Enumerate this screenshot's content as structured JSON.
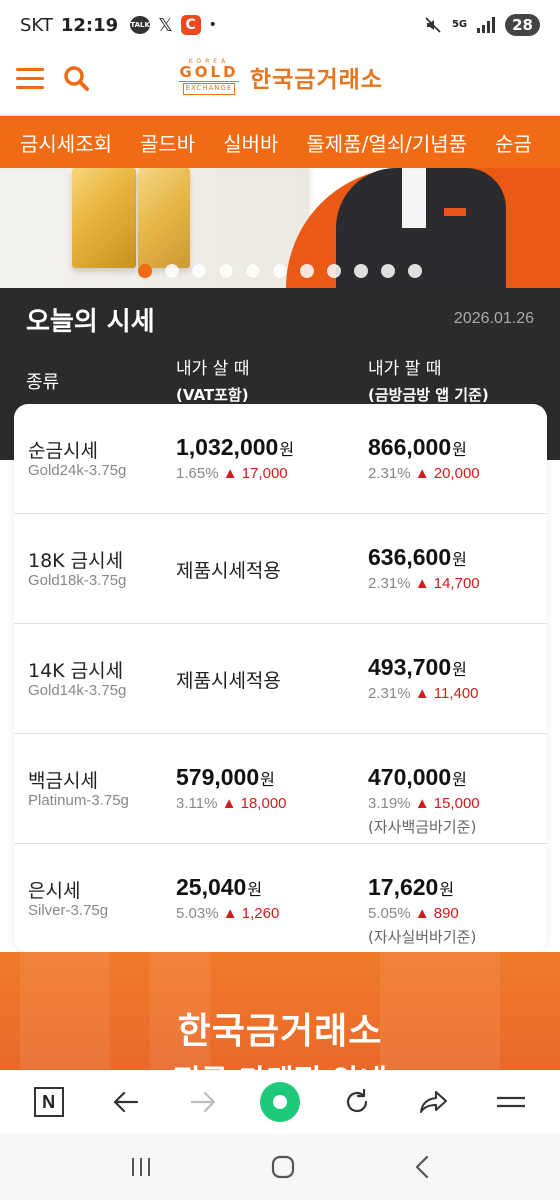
{
  "status_bar": {
    "carrier": "SKT",
    "time": "12:19",
    "talk_badge": "TALK",
    "x_icon": "𝕏",
    "c_icon": "C",
    "more_dot": "•",
    "network": "5G",
    "battery": "28"
  },
  "header": {
    "logo_korea": "KOREA",
    "logo_gold": "GOLD",
    "logo_exchange": "EXCHANGE",
    "logo_text": "한국금거래소"
  },
  "nav": {
    "items": [
      "금시세조회",
      "골드바",
      "실버바",
      "돌제품/열쇠/기념품",
      "순금"
    ]
  },
  "banner": {
    "slide_count": 11,
    "active_slide": 0
  },
  "price_section": {
    "title": "오늘의 시세",
    "date": "2026.01.26",
    "col_type": "종류",
    "col_buy": "내가 살 때",
    "col_buy_sub": "(VAT포함)",
    "col_sell": "내가 팔 때",
    "col_sell_sub": "(금방금방 앱 기준)",
    "won": "원",
    "up_arrow": "▲",
    "rows": [
      {
        "name": "순금시세",
        "sub": "Gold24k-3.75g",
        "buy_price": "1,032,000",
        "buy_pct": "1.65%",
        "buy_change": "17,000",
        "sell_price": "866,000",
        "sell_pct": "2.31%",
        "sell_change": "20,000"
      },
      {
        "name": "18K 금시세",
        "sub": "Gold18k-3.75g",
        "buy_text": "제품시세적용",
        "sell_price": "636,600",
        "sell_pct": "2.31%",
        "sell_change": "14,700"
      },
      {
        "name": "14K 금시세",
        "sub": "Gold14k-3.75g",
        "buy_text": "제품시세적용",
        "sell_price": "493,700",
        "sell_pct": "2.31%",
        "sell_change": "11,400"
      },
      {
        "name": "백금시세",
        "sub": "Platinum-3.75g",
        "buy_price": "579,000",
        "buy_pct": "3.11%",
        "buy_change": "18,000",
        "sell_price": "470,000",
        "sell_pct": "3.19%",
        "sell_change": "15,000",
        "sell_note": "(자사백금바기준)"
      },
      {
        "name": "은시세",
        "sub": "Silver-3.75g",
        "buy_price": "25,040",
        "buy_pct": "5.03%",
        "buy_change": "1,260",
        "sell_price": "17,620",
        "sell_pct": "5.05%",
        "sell_change": "890",
        "sell_note": "(자사실버바기준)"
      }
    ]
  },
  "promo": {
    "line1": "한국금거래소",
    "line2": "전국 가맹점 안내"
  },
  "browser_toolbar": {
    "n_label": "N"
  },
  "colors": {
    "brand_orange": "#f06b13",
    "dark_bg": "#2b2b2b",
    "up_red": "#d21b1b",
    "home_green": "#1ec97a"
  }
}
